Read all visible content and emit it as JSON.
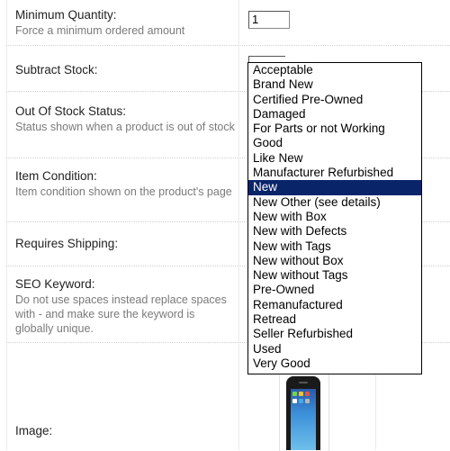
{
  "fields": {
    "min_qty": {
      "label": "Minimum Quantity:",
      "help": "Force a minimum ordered amount",
      "value": "1"
    },
    "subtract_stock": {
      "label": "Subtract Stock:"
    },
    "out_of_stock": {
      "label": "Out Of Stock Status:",
      "help": "Status shown when a product is out of stock"
    },
    "item_condition": {
      "label": "Item Condition:",
      "help": "Item condition shown on the product's page"
    },
    "requires_shipping": {
      "label": "Requires Shipping:"
    },
    "seo_keyword": {
      "label": "SEO Keyword:",
      "help": "Do not use spaces instead replace spaces with - and make sure the keyword is globally unique."
    },
    "image": {
      "label": "Image:"
    }
  },
  "condition_dropdown": {
    "selected": "New",
    "options": [
      "Acceptable",
      "Brand New",
      "Certified Pre-Owned",
      "Damaged",
      "For Parts or not Working",
      "Good",
      "Like New",
      "Manufacturer Refurbished",
      "New",
      "New Other (see details)",
      "New with Box",
      "New with Defects",
      "New with Tags",
      "New without Box",
      "New without Tags",
      "Pre-Owned",
      "Remanufactured",
      "Retread",
      "Seller Refurbished",
      "Used",
      "Very Good"
    ]
  },
  "colors": {
    "selected_bg": "#0a246a",
    "selected_fg": "#ffffff",
    "help_text": "#7a7a7a"
  },
  "icons": {
    "product_image": "phone-thumbnail"
  }
}
